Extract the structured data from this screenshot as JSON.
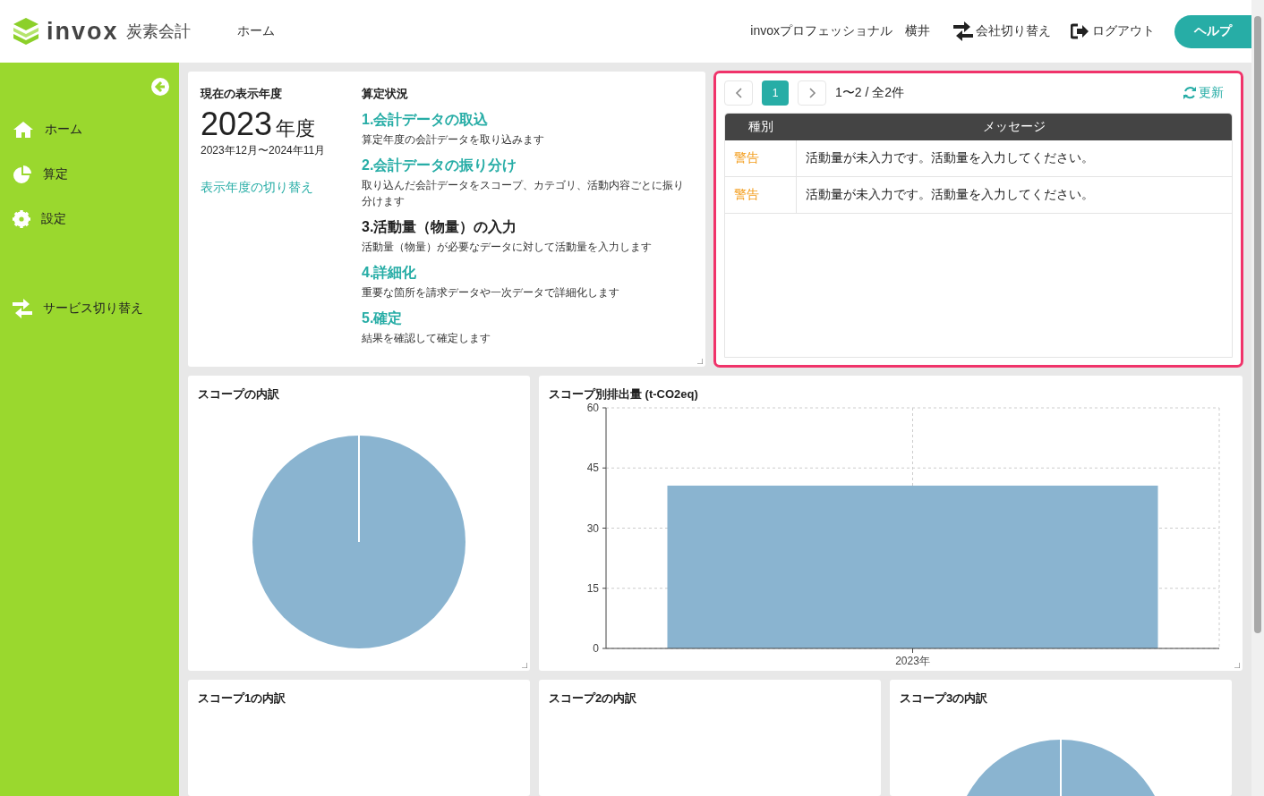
{
  "header": {
    "logo_text": "invox",
    "logo_sub": "炭素会計",
    "nav": [
      {
        "label": "ホーム"
      }
    ],
    "user_company": "invoxプロフェッショナル",
    "user_name": "横井",
    "actions": [
      {
        "kind": "switch",
        "label": "会社切り替え"
      },
      {
        "kind": "logout",
        "label": "ログアウト"
      }
    ],
    "help_button": "ヘルプ"
  },
  "sidebar": {
    "items": [
      {
        "kind": "home",
        "label": "ホーム"
      },
      {
        "kind": "chart",
        "label": "算定"
      },
      {
        "kind": "gear",
        "label": "設定"
      },
      {
        "kind": "switch",
        "label": "サービス切り替え"
      }
    ]
  },
  "year_card": {
    "heading": "現在の表示年度",
    "year": "2023",
    "year_unit": "年度",
    "period": "2023年12月〜2024年11月",
    "switch_link": "表示年度の切り替え"
  },
  "status_card": {
    "heading": "算定状況",
    "steps": [
      {
        "title": "1.会計データの取込",
        "description": "算定年度の会計データを取り込みます",
        "current": false
      },
      {
        "title": "2.会計データの振り分け",
        "description": "取り込んだ会計データをスコープ、カテゴリ、活動内容ごとに振り分けます",
        "current": false
      },
      {
        "title": "3.活動量（物量）の入力",
        "description": "活動量（物量）が必要なデータに対して活動量を入力します",
        "current": true
      },
      {
        "title": "4.詳細化",
        "description": "重要な箇所を請求データや一次データで詳細化します",
        "current": false
      },
      {
        "title": "5.確定",
        "description": "結果を確認して確定します",
        "current": false
      }
    ]
  },
  "messages": {
    "highlighted": true,
    "pages": [
      {
        "label": "1",
        "selected": true
      }
    ],
    "summary": "1〜2 / 全2件",
    "refresh": "更新",
    "columns": [
      "種別",
      "メッセージ"
    ],
    "rows": [
      {
        "type": "警告",
        "message": "活動量が未入力です。活動量を入力してください。"
      },
      {
        "type": "警告",
        "message": "活動量が未入力です。活動量を入力してください。"
      }
    ]
  },
  "scope_breakdown": {
    "title": "スコープの内訳"
  },
  "scope_emissions": {
    "title": "スコープ別排出量 (t-CO2eq)",
    "chart_data": {
      "type": "bar",
      "categories": [
        "2023年"
      ],
      "values": [
        40.6
      ],
      "ylim": [
        0,
        60
      ],
      "grid": true,
      "yticks": [
        0,
        15,
        30,
        45,
        60
      ]
    }
  },
  "scope1": {
    "title": "スコープ1の内訳"
  },
  "scope2": {
    "title": "スコープ2の内訳"
  },
  "scope3": {
    "title": "スコープ3の内訳"
  }
}
